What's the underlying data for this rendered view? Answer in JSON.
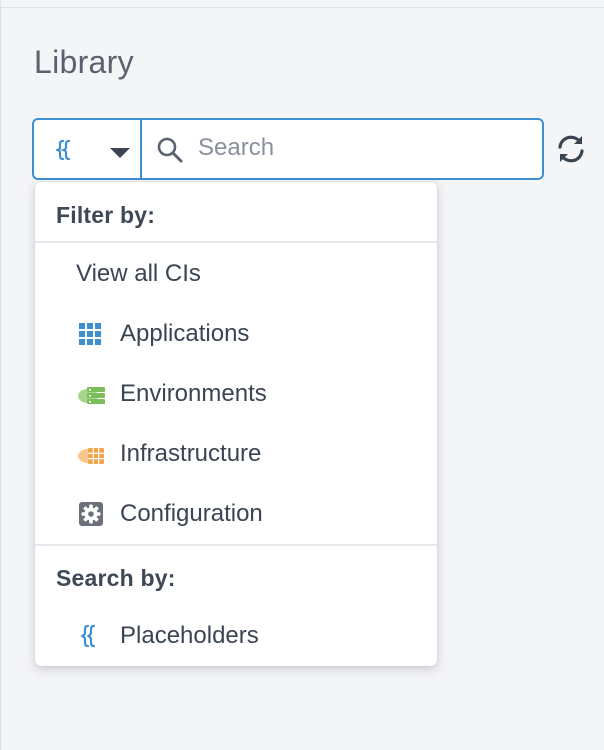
{
  "panel": {
    "title": "Library"
  },
  "search": {
    "placeholder": "Search",
    "value": ""
  },
  "dropdown": {
    "filter_header": "Filter by:",
    "filter_items": [
      {
        "label": "View all CIs",
        "icon": ""
      },
      {
        "label": "Applications",
        "icon": "applications-grid-icon"
      },
      {
        "label": "Environments",
        "icon": "environments-cloud-server-icon"
      },
      {
        "label": "Infrastructure",
        "icon": "infrastructure-cloud-grid-icon"
      },
      {
        "label": "Configuration",
        "icon": "configuration-gear-icon"
      }
    ],
    "search_header": "Search by:",
    "search_items": [
      {
        "label": "Placeholders",
        "icon": "placeholder-braces-icon"
      }
    ]
  },
  "colors": {
    "accent_blue": "#3d8fd1",
    "environments_green": "#7cbf5a",
    "infrastructure_orange": "#f3a44a",
    "configuration_gray": "#6b7079"
  }
}
